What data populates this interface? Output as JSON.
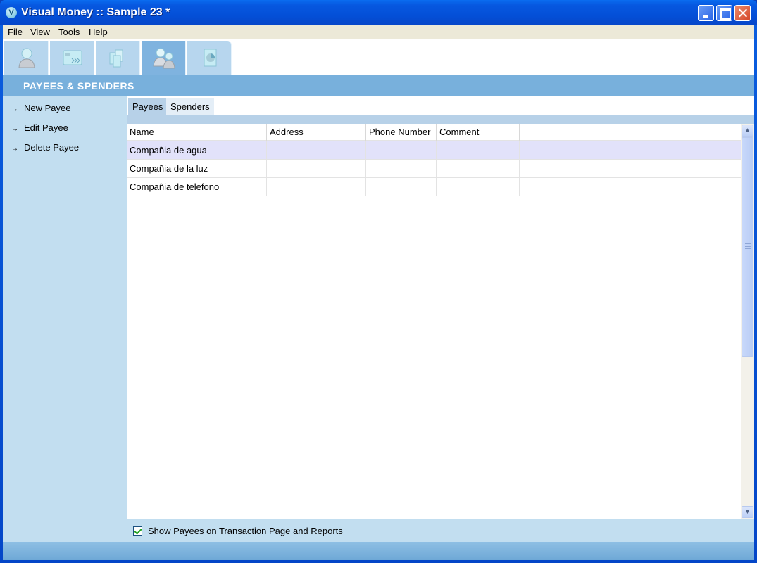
{
  "window": {
    "title": "Visual Money :: Sample 23 *",
    "app_icon_glyph": "V",
    "controls": [
      "minimize",
      "maximize",
      "close"
    ]
  },
  "menubar": {
    "items": [
      {
        "label": "File"
      },
      {
        "label": "View"
      },
      {
        "label": "Tools"
      },
      {
        "label": "Help"
      }
    ]
  },
  "toolstrip": {
    "tabs": [
      {
        "icon": "person-icon",
        "active": false
      },
      {
        "icon": "card-transfer-icon",
        "active": false
      },
      {
        "icon": "documents-icon",
        "active": false
      },
      {
        "icon": "payees-people-icon",
        "active": true
      },
      {
        "icon": "report-chart-icon",
        "active": false
      }
    ]
  },
  "section": {
    "title": "PAYEES & SPENDERS"
  },
  "sidebar": {
    "links": [
      {
        "arrow": "→",
        "label": "New Payee"
      },
      {
        "arrow": "→",
        "label": "Edit Payee"
      },
      {
        "arrow": "→",
        "label": "Delete Payee"
      }
    ]
  },
  "tabs": [
    {
      "label": "Payees",
      "active": true
    },
    {
      "label": "Spenders",
      "active": false
    }
  ],
  "grid": {
    "columns": [
      "Name",
      "Address",
      "Phone Number",
      "Comment",
      ""
    ],
    "rows": [
      {
        "name": "Compañia de agua",
        "address": "",
        "phone": "",
        "comment": "",
        "selected": true
      },
      {
        "name": "Compañia de la luz",
        "address": "",
        "phone": "",
        "comment": "",
        "selected": false
      },
      {
        "name": "Compañia de telefono",
        "address": "",
        "phone": "",
        "comment": "",
        "selected": false
      }
    ]
  },
  "footer": {
    "checkbox_label": "Show Payees on Transaction Page and Reports",
    "checked": true
  },
  "colors": {
    "titlebar": "#0450d8",
    "section_bar": "#78b0dc",
    "sidebar_bg": "#c2def0",
    "selected_row": "#e2e2fa",
    "active_tool_tab": "#7fb3df"
  }
}
